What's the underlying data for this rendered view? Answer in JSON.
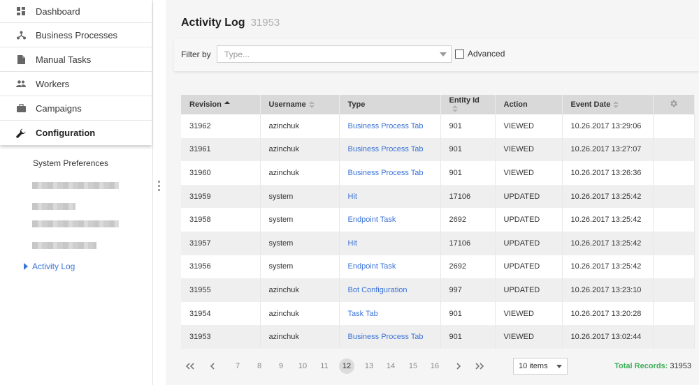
{
  "sidebar": {
    "items": [
      {
        "label": "Dashboard",
        "icon": "dashboard-icon"
      },
      {
        "label": "Business Processes",
        "icon": "process-icon"
      },
      {
        "label": "Manual Tasks",
        "icon": "document-icon"
      },
      {
        "label": "Workers",
        "icon": "people-icon"
      },
      {
        "label": "Campaigns",
        "icon": "briefcase-icon"
      },
      {
        "label": "Configuration",
        "icon": "wrench-icon"
      }
    ],
    "sub_items": {
      "system_preferences": "System Preferences",
      "activity_log": "Activity Log"
    }
  },
  "page": {
    "title": "Activity Log",
    "count": "31953"
  },
  "filter": {
    "label": "Filter by",
    "placeholder": "Type...",
    "advanced_label": "Advanced"
  },
  "table": {
    "headers": {
      "revision": "Revision",
      "username": "Username",
      "type": "Type",
      "entity_id": "Entity Id",
      "action": "Action",
      "event_date": "Event Date"
    },
    "rows": [
      {
        "revision": "31962",
        "username": "azinchuk",
        "type": "Business Process Tab",
        "entity_id": "901",
        "action": "VIEWED",
        "event_date": "10.26.2017 13:29:06"
      },
      {
        "revision": "31961",
        "username": "azinchuk",
        "type": "Business Process Tab",
        "entity_id": "901",
        "action": "VIEWED",
        "event_date": "10.26.2017 13:27:07"
      },
      {
        "revision": "31960",
        "username": "azinchuk",
        "type": "Business Process Tab",
        "entity_id": "901",
        "action": "VIEWED",
        "event_date": "10.26.2017 13:26:36"
      },
      {
        "revision": "31959",
        "username": "system",
        "type": "Hit",
        "entity_id": "17106",
        "action": "UPDATED",
        "event_date": "10.26.2017 13:25:42"
      },
      {
        "revision": "31958",
        "username": "system",
        "type": "Endpoint Task",
        "entity_id": "2692",
        "action": "UPDATED",
        "event_date": "10.26.2017 13:25:42"
      },
      {
        "revision": "31957",
        "username": "system",
        "type": "Hit",
        "entity_id": "17106",
        "action": "UPDATED",
        "event_date": "10.26.2017 13:25:42"
      },
      {
        "revision": "31956",
        "username": "system",
        "type": "Endpoint Task",
        "entity_id": "2692",
        "action": "UPDATED",
        "event_date": "10.26.2017 13:25:42"
      },
      {
        "revision": "31955",
        "username": "azinchuk",
        "type": "Bot Configuration",
        "entity_id": "997",
        "action": "UPDATED",
        "event_date": "10.26.2017 13:23:10"
      },
      {
        "revision": "31954",
        "username": "azinchuk",
        "type": "Task Tab",
        "entity_id": "901",
        "action": "VIEWED",
        "event_date": "10.26.2017 13:20:28"
      },
      {
        "revision": "31953",
        "username": "azinchuk",
        "type": "Business Process Tab",
        "entity_id": "901",
        "action": "VIEWED",
        "event_date": "10.26.2017 13:02:44"
      }
    ]
  },
  "pager": {
    "pages": [
      "7",
      "8",
      "9",
      "10",
      "11",
      "12",
      "13",
      "14",
      "15",
      "16"
    ],
    "current": "12",
    "page_size": "10 items",
    "total_label": "Total Records:",
    "total_value": "31953"
  },
  "colors": {
    "link": "#3b73d6",
    "total_label": "#3fae5a",
    "header_bg": "#d9d9d9"
  }
}
